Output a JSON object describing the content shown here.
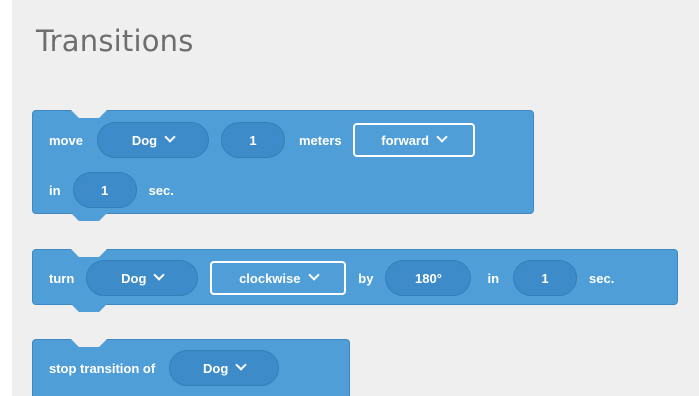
{
  "section_title": "Transitions",
  "blocks": {
    "move": {
      "label_move": "move",
      "object": "Dog",
      "distance": "1",
      "label_meters": "meters",
      "direction": "forward",
      "label_in": "in",
      "duration": "1",
      "label_sec": "sec."
    },
    "turn": {
      "label_turn": "turn",
      "object": "Dog",
      "direction": "clockwise",
      "label_by": "by",
      "angle": "180°",
      "label_in": "in",
      "duration": "1",
      "label_sec": "sec."
    },
    "stop": {
      "label_stop": "stop transition of",
      "object": "Dog"
    }
  },
  "colors": {
    "block": "#4f9ed8",
    "pill": "#3d8bc9",
    "panel": "#efefef",
    "title": "#6e6e6e"
  },
  "icons": {
    "dropdown": "chevron-down-icon"
  }
}
